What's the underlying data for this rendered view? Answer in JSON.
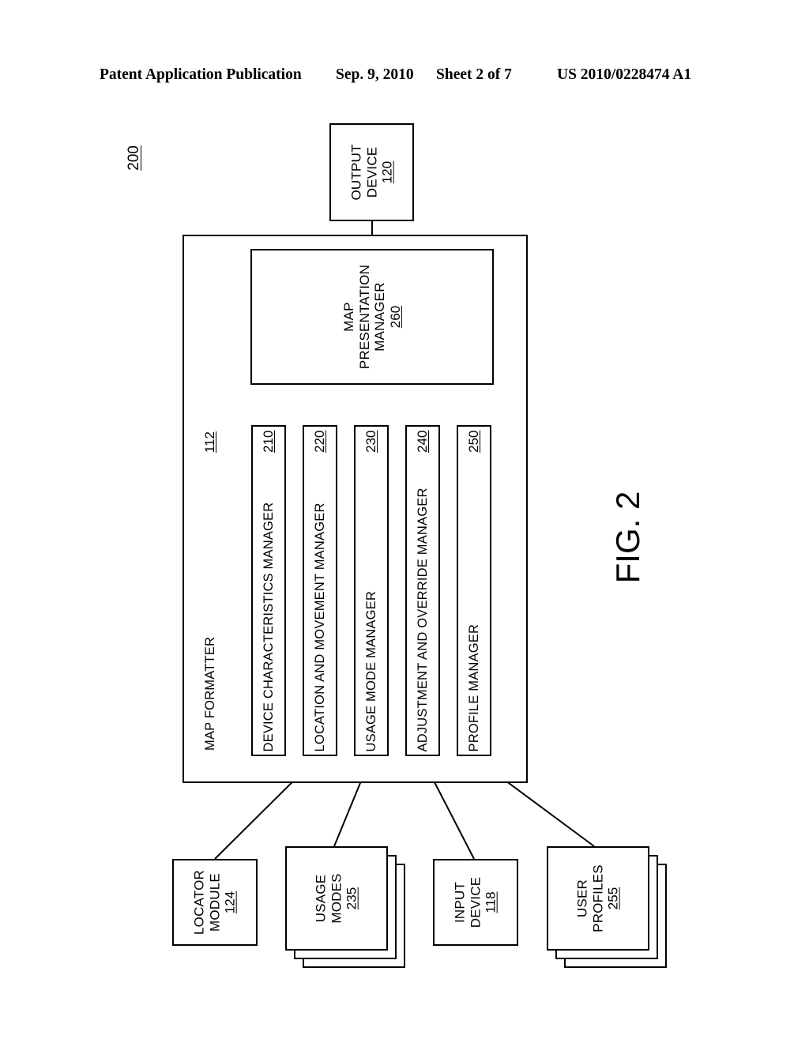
{
  "header": {
    "publication": "Patent Application Publication",
    "date": "Sep. 9, 2010",
    "sheet": "Sheet 2 of 7",
    "number": "US 2010/0228474 A1"
  },
  "figure": {
    "label": "FIG. 2",
    "system_ref": "200"
  },
  "blocks": {
    "output_device": {
      "label_line1": "OUTPUT",
      "label_line2": "DEVICE",
      "ref": "120"
    },
    "map_formatter": {
      "label": "MAP FORMATTER",
      "ref": "112"
    },
    "map_presentation_manager": {
      "label_line1": "MAP",
      "label_line2": "PRESENTATION",
      "label_line3": "MANAGER",
      "ref": "260"
    },
    "locator_module": {
      "label_line1": "LOCATOR",
      "label_line2": "MODULE",
      "ref": "124"
    },
    "usage_modes": {
      "label_line1": "USAGE",
      "label_line2": "MODES",
      "ref": "235"
    },
    "input_device": {
      "label_line1": "INPUT",
      "label_line2": "DEVICE",
      "ref": "118"
    },
    "user_profiles": {
      "label_line1": "USER",
      "label_line2": "PROFILES",
      "ref": "255"
    }
  },
  "modules": [
    {
      "label": "DEVICE CHARACTERISTICS MANAGER",
      "ref": "210"
    },
    {
      "label": "LOCATION AND MOVEMENT MANAGER",
      "ref": "220"
    },
    {
      "label": "USAGE MODE MANAGER",
      "ref": "230"
    },
    {
      "label": "ADJUSTMENT AND OVERRIDE MANAGER",
      "ref": "240"
    },
    {
      "label": "PROFILE MANAGER",
      "ref": "250"
    }
  ],
  "colors": {
    "line": "#000000",
    "background": "#ffffff"
  }
}
